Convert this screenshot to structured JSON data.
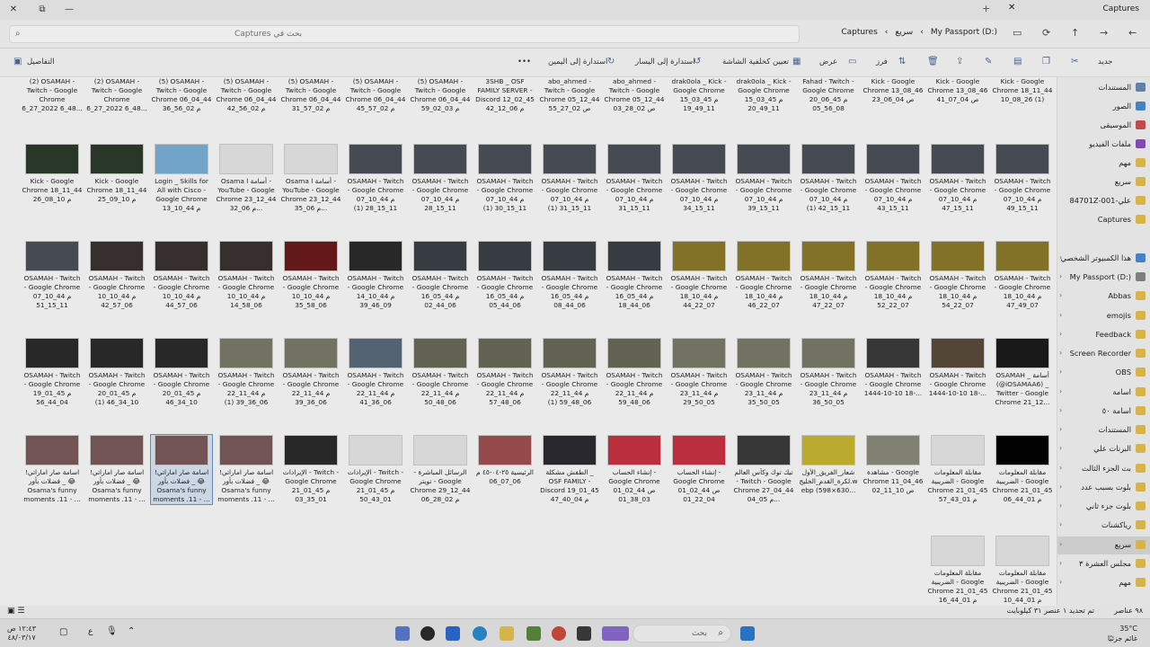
{
  "window": {
    "tab_title": "Captures",
    "controls": {
      "close": "✕",
      "restore": "⧉",
      "minimize": "—"
    }
  },
  "address": {
    "search_placeholder": "بحث في Captures",
    "breadcrumbs": [
      "My Passport (D:)",
      "سريع",
      "Captures"
    ]
  },
  "toolbar": {
    "new_label": "جديد",
    "sort_label": "فرز",
    "view_label": "عرض",
    "set_wallpaper_label": "تعيين كخلفية الشاشة",
    "rotate_left_label": "استدارة إلى اليسار",
    "rotate_right_label": "استدارة إلى اليمين",
    "more_label": "•••",
    "details_label": "التفاصيل"
  },
  "rows": [
    [
      {
        "caption": "Kick - Google Chrome 18_11_44 10_08_26 (1)",
        "color": "#cfcfcf"
      },
      {
        "caption": "Kick - Google Chrome 13_08_46 ص 04_07_41",
        "color": "#cfcfcf"
      },
      {
        "caption": "Kick - Google Chrome 13_08_46 ص 04_06_23",
        "color": "#cfcfcf"
      },
      {
        "caption": "Fahad - Twitch - Google Chrome 20_06_45 م 08_56_05",
        "color": "#cfcfcf"
      },
      {
        "caption": "drak0ola _ Kick - Google Chrome 15_03_45 م 11_49_20",
        "color": "#cfcfcf"
      },
      {
        "caption": "drak0ola _ Kick - Google Chrome 15_03_45 م 11_49_19",
        "color": "#cfcfcf"
      },
      {
        "caption": "abo_ahmed - Twitch - Google Chrome 05_12_44 ص 02_28_03",
        "color": "#cfcfcf"
      },
      {
        "caption": "abo_ahmed - Twitch - Google Chrome 05_12_44 ص 02_27_55",
        "color": "#cfcfcf"
      },
      {
        "caption": "3SHB _ OSF FAMILY SERVER - Discord 12_02_45 م 06_12_42",
        "color": "#cfcfcf"
      },
      {
        "caption": "(5) OSAMAH - Twitch - Google Chrome 06_04_44 م 03_02_59",
        "color": "#cfcfcf"
      },
      {
        "caption": "(5) OSAMAH - Twitch - Google Chrome 06_04_44 م 02_57_45",
        "color": "#cfcfcf"
      },
      {
        "caption": "(5) OSAMAH - Twitch - Google Chrome 06_04_44 م 02_57_31",
        "color": "#cfcfcf"
      },
      {
        "caption": "(5) OSAMAH - Twitch - Google Chrome 06_04_44 م 02_56_42",
        "color": "#cfcfcf"
      },
      {
        "caption": "(5) OSAMAH - Twitch - Google Chrome 06_04_44 م 02_56_36",
        "color": "#cfcfcf"
      },
      {
        "caption": "(2) OSAMAH - Twitch - Google Chrome 6_27_2022 6_48...",
        "color": "#cfcfcf"
      },
      {
        "caption": "(2) OSAMAH - Twitch - Google Chrome 6_27_2022 6_48...",
        "color": "#cfcfcf"
      }
    ],
    [
      {
        "caption": "OSAMAH - Twitch - Google Chrome 07_10_44 م 11_15_49",
        "color": "#4a4f58"
      },
      {
        "caption": "OSAMAH - Twitch - Google Chrome 07_10_44 م 11_15_47",
        "color": "#4a4f58"
      },
      {
        "caption": "OSAMAH - Twitch - Google Chrome 07_10_44 م 11_15_43",
        "color": "#4a4f58"
      },
      {
        "caption": "OSAMAH - Twitch - Google Chrome 07_10_44 م 11_15_42 (1)",
        "color": "#4a4f58"
      },
      {
        "caption": "OSAMAH - Twitch - Google Chrome 07_10_44 م 11_15_39",
        "color": "#4a4f58"
      },
      {
        "caption": "OSAMAH - Twitch - Google Chrome 07_10_44 م 11_15_34",
        "color": "#4a4f58"
      },
      {
        "caption": "OSAMAH - Twitch - Google Chrome 07_10_44 م 11_15_31",
        "color": "#4a4f58"
      },
      {
        "caption": "OSAMAH - Twitch - Google Chrome 07_10_44 م 11_15_31 (1)",
        "color": "#4a4f58"
      },
      {
        "caption": "OSAMAH - Twitch - Google Chrome 07_10_44 م 11_15_30 (1)",
        "color": "#4a4f58"
      },
      {
        "caption": "OSAMAH - Twitch - Google Chrome 07_10_44 م 11_15_28",
        "color": "#4a4f58"
      },
      {
        "caption": "OSAMAH - Twitch - Google Chrome 07_10_44 م 11_15_28 (1)",
        "color": "#4a4f58"
      },
      {
        "caption": "Osama l أسامة - YouTube - Google Chrome 23_12_44 م 06_35...",
        "color": "#e8e8e8"
      },
      {
        "caption": "Osama l أسامة - YouTube - Google Chrome 23_12_44 م 06_32...",
        "color": "#e8e8e8"
      },
      {
        "caption": "Login _ Skills for All with Cisco - Google Chrome 13_10_44 م 11_33...",
        "color": "#7ab0d8"
      },
      {
        "caption": "Kick - Google Chrome 18_11_44 م 10_09_25",
        "color": "#2a3a2a"
      },
      {
        "caption": "Kick - Google Chrome 18_11_44 م 10_08_26",
        "color": "#2a3a2a"
      }
    ],
    [
      {
        "caption": "OSAMAH - Twitch - Google Chrome 18_10_44 م 07_49_47",
        "color": "#8a7a2a"
      },
      {
        "caption": "OSAMAH - Twitch - Google Chrome 18_10_44 م 07_22_54",
        "color": "#8a7a2a"
      },
      {
        "caption": "OSAMAH - Twitch - Google Chrome 18_10_44 م 07_22_52",
        "color": "#8a7a2a"
      },
      {
        "caption": "OSAMAH - Twitch - Google Chrome 18_10_44 م 07_22_47",
        "color": "#8a7a2a"
      },
      {
        "caption": "OSAMAH - Twitch - Google Chrome 18_10_44 م 07_22_46",
        "color": "#8a7a2a"
      },
      {
        "caption": "OSAMAH - Twitch - Google Chrome 18_10_44 م 07_22_44",
        "color": "#8a7a2a"
      },
      {
        "caption": "OSAMAH - Twitch - Google Chrome 16_05_44 م 06_44_18",
        "color": "#3a3f46"
      },
      {
        "caption": "OSAMAH - Twitch - Google Chrome 16_05_44 م 06_44_08",
        "color": "#3a3f46"
      },
      {
        "caption": "OSAMAH - Twitch - Google Chrome 16_05_44 م 06_44_05",
        "color": "#3a3f46"
      },
      {
        "caption": "OSAMAH - Twitch - Google Chrome 16_05_44 م 06_44_02",
        "color": "#3a3f46"
      },
      {
        "caption": "OSAMAH - Twitch - Google Chrome 14_10_44 م 09_46_39",
        "color": "#2a2a2a"
      },
      {
        "caption": "OSAMAH - Twitch - Google Chrome 10_10_44 م 06_58_35",
        "color": "#6a1a1a"
      },
      {
        "caption": "OSAMAH - Twitch - Google Chrome 10_10_44 م 06_58_14",
        "color": "#3a3030"
      },
      {
        "caption": "OSAMAH - Twitch - Google Chrome 10_10_44 م 06_57_44",
        "color": "#3a3030"
      },
      {
        "caption": "OSAMAH - Twitch - Google Chrome 10_10_44 م 06_57_42",
        "color": "#3a3030"
      },
      {
        "caption": "OSAMAH - Twitch - Google Chrome 07_10_44 م 11_15_51",
        "color": "#4a4f58"
      }
    ],
    [
      {
        "caption": "OSAMAH _ أسامة (@iOSAMAA6) _ Twitter - Google Chrome 21_12...",
        "color": "#1a1a1a"
      },
      {
        "caption": "OSAMAH - Twitch - Google Chrome 1444-10-10 18-...",
        "color": "#5a4a3a"
      },
      {
        "caption": "OSAMAH - Twitch - Google Chrome 1444-10-10 18-...",
        "color": "#3a3a3a"
      },
      {
        "caption": "OSAMAH - Twitch - Google Chrome 23_11_44 م 05_50_36",
        "color": "#7a7a6a"
      },
      {
        "caption": "OSAMAH - Twitch - Google Chrome 23_11_44 م 05_50_35",
        "color": "#7a7a6a"
      },
      {
        "caption": "OSAMAH - Twitch - Google Chrome 23_11_44 م 05_50_29",
        "color": "#7a7a6a"
      },
      {
        "caption": "OSAMAH - Twitch - Google Chrome 22_11_44 م 06_48_59",
        "color": "#6a6a5a"
      },
      {
        "caption": "OSAMAH - Twitch - Google Chrome 22_11_44 م 06_48_59 (1)",
        "color": "#6a6a5a"
      },
      {
        "caption": "OSAMAH - Twitch - Google Chrome 22_11_44 م 06_48_57",
        "color": "#6a6a5a"
      },
      {
        "caption": "OSAMAH - Twitch - Google Chrome 22_11_44 م 06_48_50",
        "color": "#6a6a5a"
      },
      {
        "caption": "OSAMAH - Twitch - Google Chrome 22_11_44 م 06_36_41",
        "color": "#5a6a7a"
      },
      {
        "caption": "OSAMAH - Twitch - Google Chrome 22_11_44 م 06_36_39",
        "color": "#7a7a6a"
      },
      {
        "caption": "OSAMAH - Twitch - Google Chrome 22_11_44 م 06_36_39 (1)",
        "color": "#7a7a6a"
      },
      {
        "caption": "OSAMAH - Twitch - Google Chrome 20_01_45 م 10_34_46",
        "color": "#2a2a2a"
      },
      {
        "caption": "OSAMAH - Twitch - Google Chrome 20_01_45 م 10_34_46 (1)",
        "color": "#2a2a2a"
      },
      {
        "caption": "OSAMAH - Twitch - Google Chrome 19_01_45 م 04_44_56",
        "color": "#2a2a2a"
      }
    ],
    [
      {
        "caption": "مقابلة المعلومات الضريبية - Google Chrome 21_01_45 م 01_44_06",
        "color": "#000000"
      },
      {
        "caption": "مقابلة المعلومات الضريبية - Google Chrome 21_01_45 م 01_43_57",
        "color": "#e8e8e8"
      },
      {
        "caption": "مشاهدة - Google Chrome 11_04_46 ص 10_11_02",
        "color": "#8a8a7a"
      },
      {
        "caption": "شعار_الفريق_الأول لكرة_القدم_الخليج.webp (598×630...",
        "color": "#c8b830"
      },
      {
        "caption": "تيك توك وكأس العالم - Twitch - Google Chrome 27_04_44 م 05_04...",
        "color": "#3a3a3a"
      },
      {
        "caption": "إنشاء الحساب - Google Chrome 01_02_44 ص 04_22_01",
        "color": "#c83040"
      },
      {
        "caption": "إنشاء الحساب - Google Chrome 01_02_44 ص 03_38_01",
        "color": "#c83040"
      },
      {
        "caption": "الطفش مشكلة _ OSF FAMILY - Discord 19_01_45 م 04_40_47",
        "color": "#2a2a30"
      },
      {
        "caption": "الرئيسية ٢٥-٠٤-٤٥ م 06_07_06",
        "color": "#a05050"
      },
      {
        "caption": "الرسائل المباشرة - تويتر - Google Chrome 29_12_44 م 02_28_06",
        "color": "#e8e8e8"
      },
      {
        "caption": "الإيرادات - Twitch - Google Chrome 21_01_45 م 01_43_50",
        "color": "#e8e8e8"
      },
      {
        "caption": "الإيرادات - Twitch - Google Chrome 21_01_45 م 01_35_03",
        "color": "#2a2a2a"
      },
      {
        "caption": "اسامة صار اماراتي! فضلات بأور _ 😂 Osama's funny moments .11 - ...",
        "color": "#7a5a5a"
      },
      {
        "caption": "اسامة صار اماراتي! فضلات بأور _ 😂 Osama's funny moments .11 - ...",
        "color": "#7a5a5a"
      },
      {
        "caption": "اسامة صار اماراتي! فضلات بأور _ 😂 Osama's funny moments .11 - ...",
        "color": "#7a5a5a"
      },
      {
        "caption": "اسامة صار اماراتي! فضلات بأور _ 😂 Osama's funny moments .11 - ...",
        "color": "#7a5a5a"
      }
    ],
    [
      {
        "caption": "مقابلة المعلومات الضريبية - Google Chrome 21_01_45 م 01_44_16",
        "color": "#e8e8e8"
      },
      {
        "caption": "مقابلة المعلومات الضريبية - Google Chrome 21_01_45 م 01_44_10",
        "color": "#e8e8e8"
      }
    ]
  ],
  "sidebar": [
    {
      "label": "المستندات",
      "color": "#6a8ab0"
    },
    {
      "label": "الصور",
      "color": "#4a8ad0"
    },
    {
      "label": "الموسيقى",
      "color": "#d05050"
    },
    {
      "label": "ملفات الفيديو",
      "color": "#8a50c0"
    },
    {
      "label": "مهم",
      "color": "#e8c050"
    },
    {
      "label": "سريع",
      "color": "#e8c050"
    },
    {
      "label": "علي-001-84701Z",
      "color": "#e8c050"
    },
    {
      "label": "Captures",
      "color": "#e8c050"
    },
    {
      "label": "",
      "color": ""
    },
    {
      "label": "هذا الكمبيوتر الشخصي",
      "color": "#4a8ad0"
    },
    {
      "label": "My Passport (D:)",
      "color": "#888888"
    },
    {
      "label": "Abbas",
      "color": "#e8c050"
    },
    {
      "label": "emojis",
      "color": "#e8c050"
    },
    {
      "label": "Feedback",
      "color": "#e8c050"
    },
    {
      "label": "Screen Recorder",
      "color": "#e8c050"
    },
    {
      "label": "OBS",
      "color": "#e8c050"
    },
    {
      "label": "اسامة",
      "color": "#e8c050"
    },
    {
      "label": "اسامة ٥٠",
      "color": "#e8c050"
    },
    {
      "label": "المستندات",
      "color": "#e8c050"
    },
    {
      "label": "البرنات علي",
      "color": "#e8c050"
    },
    {
      "label": "بث الجزء الثالث",
      "color": "#e8c050"
    },
    {
      "label": "بلوت بسبب عدد",
      "color": "#e8c050"
    },
    {
      "label": "بلوت جزء ثاني",
      "color": "#e8c050"
    },
    {
      "label": "رياكشنات",
      "color": "#e8c050"
    },
    {
      "label": "سريع",
      "color": "#e8c050"
    },
    {
      "label": "مجلس العشرة ٣",
      "color": "#e8c050"
    },
    {
      "label": "مهم",
      "color": "#e8c050"
    }
  ],
  "status": {
    "count": "٩٨ عناصر",
    "selection": "تم تحديد ١ عنصر ٣١ كيلوبايت"
  },
  "taskbar": {
    "search_placeholder": "بحث",
    "time": "١٢:٤٣ ص",
    "date": "٤٨/٠٣/١٧",
    "lang": "ع",
    "temp": "35°C",
    "weather": "غائم جزئيًا"
  }
}
